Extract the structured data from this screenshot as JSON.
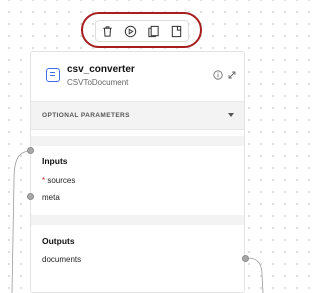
{
  "toolbar": {
    "buttons": [
      {
        "icon": "trash-icon",
        "label": "delete"
      },
      {
        "icon": "play-icon",
        "label": "run"
      },
      {
        "icon": "copy-icon",
        "label": "duplicate"
      },
      {
        "icon": "bookmark-icon",
        "label": "save"
      }
    ]
  },
  "node": {
    "title": "csv_converter",
    "subtitle": "CSVToDocument",
    "icon": "document-icon",
    "optional_label": "OPTIONAL PARAMETERS",
    "inputs": {
      "title": "Inputs",
      "items": [
        {
          "label": "sources",
          "required": true,
          "required_mark": "*"
        },
        {
          "label": "meta",
          "required": false
        }
      ]
    },
    "outputs": {
      "title": "Outputs",
      "items": [
        {
          "label": "documents"
        }
      ]
    }
  },
  "colors": {
    "highlight": "#a61e1e",
    "accent": "#3d6fe6",
    "required": "#d32222"
  }
}
